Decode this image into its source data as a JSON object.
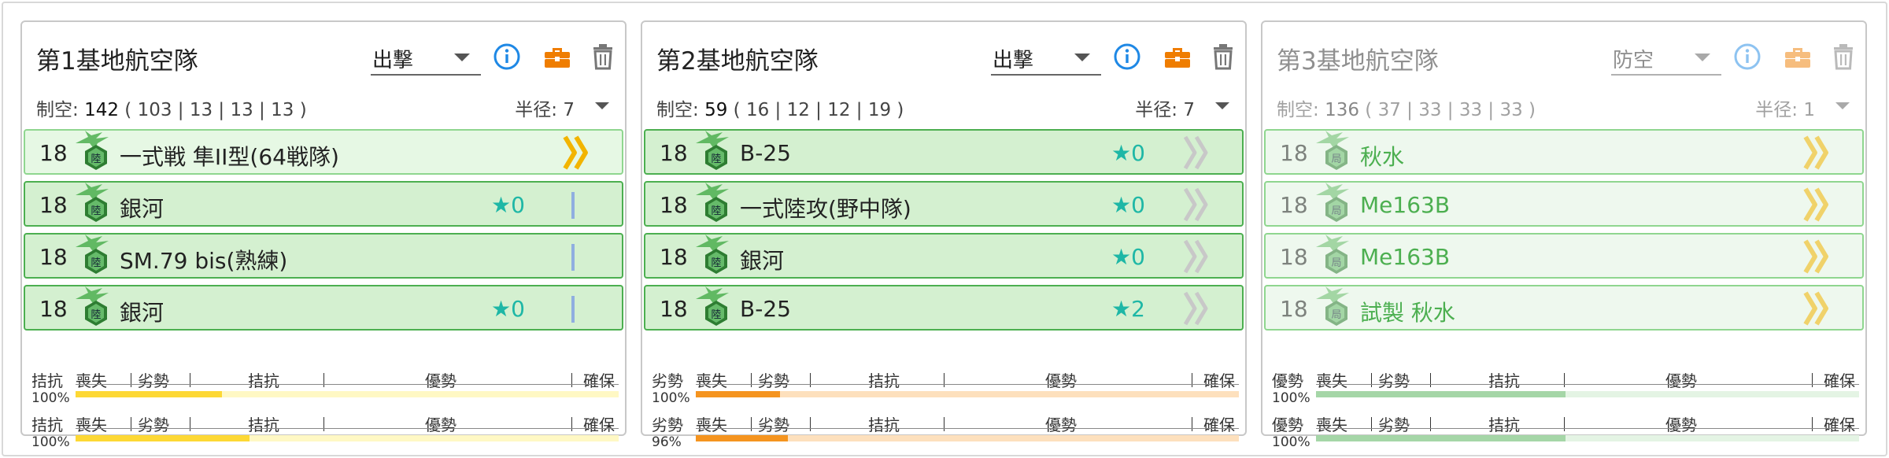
{
  "colors": {
    "accent_blue": "#1e88e5",
    "briefcase_orange": "#ef7d00",
    "star_teal": "#1eb7a6",
    "slot_green_border": "#4caf50",
    "slot_green_bg": "#d4f0d0",
    "bar_yellow": "#fdd835",
    "bar_orange": "#f5941f",
    "bar_green": "#a5d6a7"
  },
  "panels": [
    {
      "title": "第1基地航空隊",
      "mode": "出撃",
      "stats_label": "制空:",
      "stats_value": "142",
      "stats_breakdown": "( 103 | 13 | 13 | 13 )",
      "radius_label": "半径: 7",
      "disabled": false,
      "slots": [
        {
          "count": "18",
          "name": "一式戦 隼II型(64戦隊)",
          "stars": "",
          "icon": "army-fighter-icon",
          "proficiency": "max"
        },
        {
          "count": "18",
          "name": "銀河",
          "stars": "0",
          "icon": "army-fighter-icon",
          "proficiency": "one"
        },
        {
          "count": "18",
          "name": "SM.79 bis(熟練)",
          "stars": "",
          "icon": "army-fighter-icon",
          "proficiency": "one"
        },
        {
          "count": "18",
          "name": "銀河",
          "stars": "0",
          "icon": "army-fighter-icon",
          "proficiency": "one"
        }
      ],
      "air_bars": [
        {
          "status": "拮抗",
          "percent": "100%",
          "fill": 0.27,
          "color": "#fdd835",
          "track": "#fff8c4"
        },
        {
          "status": "拮抗",
          "percent": "100%",
          "fill": 0.32,
          "color": "#fdd835",
          "track": "#fff8c4"
        }
      ]
    },
    {
      "title": "第2基地航空隊",
      "mode": "出撃",
      "stats_label": "制空:",
      "stats_value": "59",
      "stats_breakdown": "( 16 | 12 | 12 | 19 )",
      "radius_label": "半径: 7",
      "disabled": false,
      "slots": [
        {
          "count": "18",
          "name": "B-25",
          "stars": "0",
          "icon": "army-fighter-icon",
          "proficiency": "none"
        },
        {
          "count": "18",
          "name": "一式陸攻(野中隊)",
          "stars": "0",
          "icon": "army-fighter-icon",
          "proficiency": "none"
        },
        {
          "count": "18",
          "name": "銀河",
          "stars": "0",
          "icon": "army-fighter-icon",
          "proficiency": "none"
        },
        {
          "count": "18",
          "name": "B-25",
          "stars": "2",
          "icon": "army-fighter-icon",
          "proficiency": "none"
        }
      ],
      "air_bars": [
        {
          "status": "劣勢",
          "percent": "100%",
          "fill": 0.155,
          "color": "#f5941f",
          "track": "#fde0bd"
        },
        {
          "status": "劣勢",
          "percent": "96%",
          "fill": 0.17,
          "color": "#f5941f",
          "track": "#fde0bd"
        }
      ]
    },
    {
      "title": "第3基地航空隊",
      "mode": "防空",
      "stats_label": "制空:",
      "stats_value": "136",
      "stats_breakdown": "( 37 | 33 | 33 | 33 )",
      "radius_label": "半径: 1",
      "disabled": true,
      "slots": [
        {
          "count": "18",
          "name": "秋水",
          "stars": "",
          "icon": "local-fighter-icon",
          "proficiency": "max"
        },
        {
          "count": "18",
          "name": "Me163B",
          "stars": "",
          "icon": "local-fighter-icon",
          "proficiency": "max"
        },
        {
          "count": "18",
          "name": "Me163B",
          "stars": "",
          "icon": "local-fighter-icon",
          "proficiency": "max"
        },
        {
          "count": "18",
          "name": "試製 秋水",
          "stars": "",
          "icon": "local-fighter-icon",
          "proficiency": "max"
        }
      ],
      "air_bars": [
        {
          "status": "優勢",
          "percent": "100%",
          "fill": 0.46,
          "color": "#a5d6a7",
          "track": "#e4f4e4"
        },
        {
          "status": "優勢",
          "percent": "100%",
          "fill": 0.46,
          "color": "#a5d6a7",
          "track": "#e4f4e4"
        }
      ]
    }
  ],
  "scale_labels": [
    "喪失",
    "劣勢",
    "拮抗",
    "優勢",
    "確保"
  ]
}
